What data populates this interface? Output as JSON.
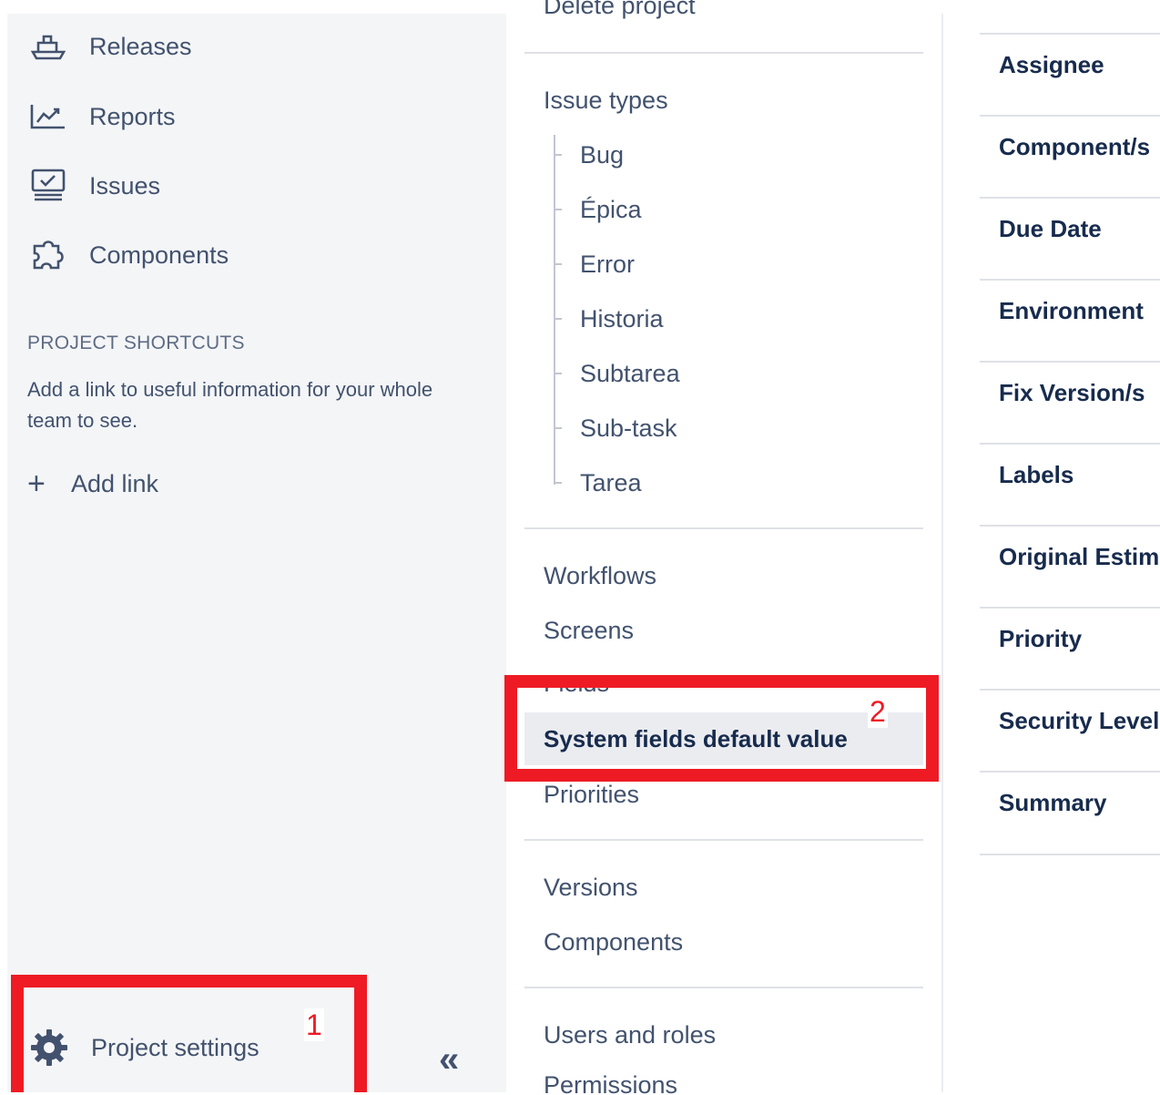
{
  "sidebar": {
    "items": [
      {
        "label": "Releases",
        "icon": "ship-icon"
      },
      {
        "label": "Reports",
        "icon": "chart-icon"
      },
      {
        "label": "Issues",
        "icon": "issues-icon"
      },
      {
        "label": "Components",
        "icon": "puzzle-icon"
      }
    ],
    "shortcuts_title": "PROJECT SHORTCUTS",
    "shortcuts_desc": "Add a link to useful information for your whole team to see.",
    "add_link_label": "Add link",
    "add_link_icon": "plus-icon",
    "settings_label": "Project settings",
    "settings_icon": "gear-icon",
    "collapse_glyph": "«"
  },
  "menu": {
    "top_clipped_item": "Delete project",
    "issue_types_label": "Issue types",
    "issue_types": [
      "Bug",
      "Épica",
      "Error",
      "Historia",
      "Subtarea",
      "Sub-task",
      "Tarea"
    ],
    "workflows": "Workflows",
    "screens": "Screens",
    "fields": "Fields",
    "system_fields_default": "System fields default value",
    "priorities": "Priorities",
    "versions": "Versions",
    "components": "Components",
    "users_and_roles": "Users and roles",
    "permissions": "Permissions"
  },
  "fields": [
    "Assignee",
    "Component/s",
    "Due Date",
    "Environment",
    "Fix Version/s",
    "Labels",
    "Original Estimate",
    "Priority",
    "Security Level",
    "Summary"
  ],
  "annotations": {
    "label_1": "1",
    "label_2": "2",
    "color": "#ee1b24"
  }
}
